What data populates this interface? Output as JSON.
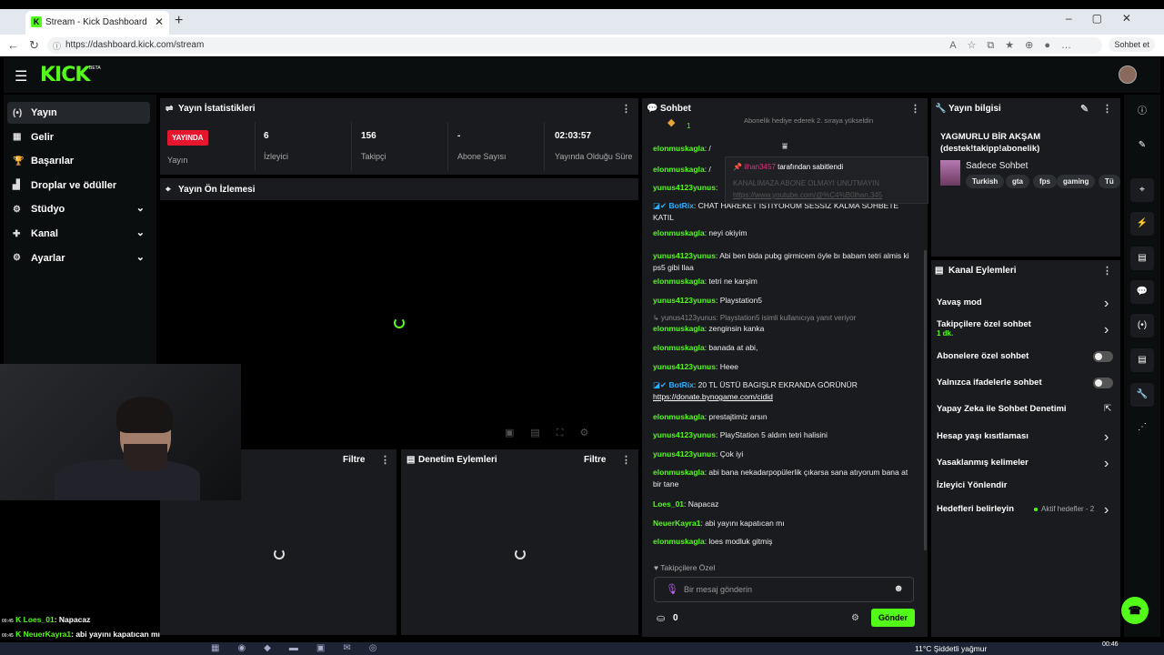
{
  "browser": {
    "tab_title": "Stream - Kick Dashboard",
    "tab_favicon": "K",
    "url": "https://dashboard.kick.com/stream",
    "sohbet_button": "Sohbet et"
  },
  "header": {
    "logo": "KICK",
    "beta": "BETA"
  },
  "nav": [
    {
      "label": "Yayın",
      "icon": "broadcast-icon",
      "glyph": "(•)",
      "active": true
    },
    {
      "label": "Gelir",
      "icon": "revenue-icon",
      "glyph": "▦"
    },
    {
      "label": "Başarılar",
      "icon": "trophy-icon",
      "glyph": "🏆"
    },
    {
      "label": "Droplar ve ödüller",
      "icon": "drops-icon",
      "glyph": "▟"
    },
    {
      "label": "Stüdyo",
      "icon": "studio-icon",
      "glyph": "⚙",
      "expand": true
    },
    {
      "label": "Kanal",
      "icon": "channel-icon",
      "glyph": "✚",
      "expand": true
    },
    {
      "label": "Ayarlar",
      "icon": "settings-icon",
      "glyph": "⚙",
      "expand": true
    }
  ],
  "stats": {
    "title": "Yayın İstatistikleri",
    "live_badge": "YAYINDA",
    "live_label": "Yayın",
    "viewers": "6",
    "viewers_label": "İzleyici",
    "followers": "156",
    "followers_label": "Takipçi",
    "subs": "-",
    "subs_label": "Abone Sayısı",
    "uptime": "02:03:57",
    "uptime_label": "Yayında Olduğu Süre"
  },
  "preview": {
    "title": "Yayın Ön İzlemesi"
  },
  "bottom_left": {
    "filter": "Filtre"
  },
  "moderation": {
    "title": "Denetim Eylemleri",
    "filter": "Filtre"
  },
  "chat": {
    "title": "Sohbet",
    "top_partial": "Abonelik hediye ederek 2. sıraya yükseldin",
    "top_count": "1",
    "pinned_user": "ilhan3457",
    "pinned_by": "tarafından sabitlendi",
    "pinned_text": "KANALIMAZA ABONE OLMAYI UNUTMAYIN",
    "pinned_link": "https://www.youtube.com/@%C4%B0lhan.345",
    "messages": [
      {
        "user": "elonmuskagla",
        "text": "/",
        "bot": false
      },
      {
        "user": "elonmuskagla",
        "text": "/",
        "bot": false
      },
      {
        "user": "yunus4123yunus",
        "text": "",
        "bot": false
      },
      {
        "user": "BotRix",
        "text": "CHAT HAREKET İSTİYORUM SESSİZ KALMA SOHBETE KATIL",
        "bot": true
      },
      {
        "user": "elonmuskagla",
        "text": "neyi okiyim",
        "bot": false
      },
      {
        "user": "yunus4123yunus",
        "text": "Abi ben bida pubg girmicem öyle bı babam tetri almis ki ps5 gibi llaa",
        "bot": false
      },
      {
        "user": "elonmuskagla",
        "text": "tetri ne karşim",
        "bot": false
      },
      {
        "user": "yunus4123yunus",
        "text": "Playstation5",
        "bot": false
      },
      {
        "reply": "yunus4123yunus: Playstation5 isimli kullanıcıya yanıt veriyor"
      },
      {
        "user": "elonmuskagla",
        "text": "zenginsin kanka",
        "bot": false
      },
      {
        "user": "elonmuskagla",
        "text": "banada at abi,",
        "bot": false
      },
      {
        "user": "yunus4123yunus",
        "text": "Heee",
        "bot": false
      },
      {
        "user": "BotRix",
        "text": "20 TL ÜSTÜ BAGIŞLR EKRANDA GÖRÜNÜR",
        "link": "https://donate.bynogame.com/cidid",
        "bot": true
      },
      {
        "user": "elonmuskagla",
        "text": "prestajtimiz arsın",
        "bot": false
      },
      {
        "user": "yunus4123yunus",
        "text": "PlayStation 5 aldım tetri halisini",
        "bot": false
      },
      {
        "user": "yunus4123yunus",
        "text": "Çok iyi",
        "bot": false
      },
      {
        "user": "elonmuskagla",
        "text": "abi bana nekadarpopülerlik çıkarsa sana atıyorum bana at bir tane",
        "bot": false
      },
      {
        "user": "Loes_01",
        "text": "Napacaz",
        "bot": false
      },
      {
        "user": "NeuerKayra1",
        "text": "abi yayını kapatıcan mı",
        "bot": false
      },
      {
        "user": "elonmuskagla",
        "text": "loes modluk gitmiş",
        "bot": false
      }
    ],
    "follower_only": "Takipçilere Özel",
    "input_placeholder": "Bir mesaj gönderin",
    "gift_count": "0",
    "send": "Gönder"
  },
  "stream_info": {
    "title": "Yayın bilgisi",
    "stream_title": "YAGMURLU BİR AKŞAM (destek!takipp!abonelik)",
    "category": "Sadece Sohbet",
    "tags": [
      "Turkish",
      "gta",
      "fps",
      "gaming",
      "Tü"
    ]
  },
  "channel_actions": {
    "title": "Kanal Eylemleri",
    "items": [
      {
        "label": "Yavaş mod",
        "control": "arrow"
      },
      {
        "label": "Takipçilere özel sohbet",
        "sub": "1 dk.",
        "control": "arrow"
      },
      {
        "label": "Abonelere özel sohbet",
        "control": "toggle"
      },
      {
        "label": "Yalnızca ifadelerle sohbet",
        "control": "toggle"
      },
      {
        "label": "Yapay Zeka ile Sohbet Denetimi",
        "control": "external"
      },
      {
        "label": "Hesap yaşı kısıtlaması",
        "control": "arrow"
      },
      {
        "label": "Yasaklanmış kelimeler",
        "control": "arrow"
      },
      {
        "label": "İzleyici Yönlendir",
        "control": "none"
      },
      {
        "label": "Hedefleri belirleyin",
        "sub_inline": "Aktif hedefler - 2",
        "control": "arrow"
      }
    ]
  },
  "overlay_chat": [
    {
      "time": "00:45",
      "user": "Loes_01",
      "text": ": Napacaz"
    },
    {
      "time": "00:45",
      "user": "NeuerKayra1",
      "text": ": abi yayını kapatıcan mı"
    },
    {
      "time": "00:45",
      "user": "elonmuskagla",
      "text": ": loes modluk gitmiş"
    }
  ],
  "taskbar": {
    "weather": "11°C  Şiddetli yağmur",
    "time": "00:46"
  },
  "colors": {
    "accent": "#53fc18",
    "live": "#e5162e",
    "panel": "#191b1f",
    "bot_name": "#2bb1ff"
  }
}
